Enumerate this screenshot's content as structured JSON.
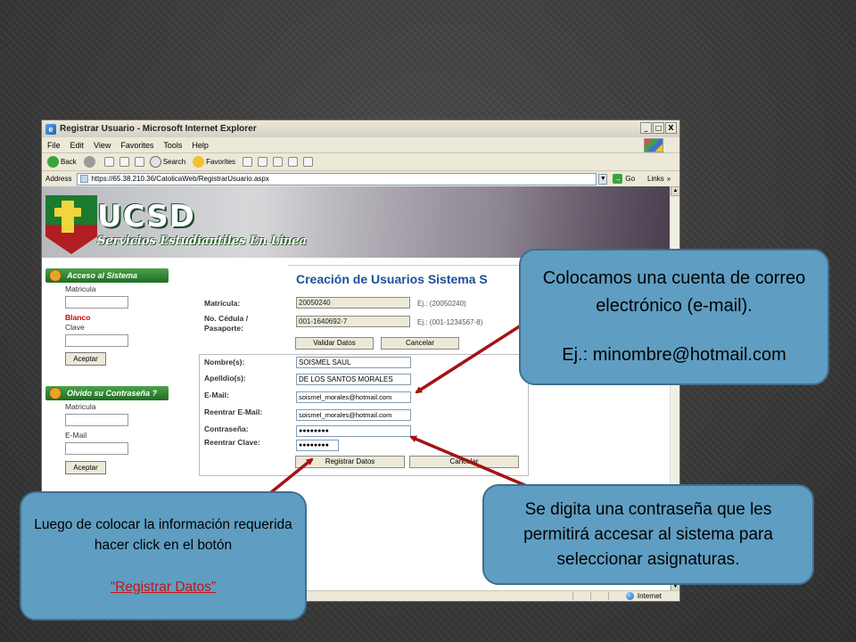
{
  "window": {
    "title": "Registrar Usuario - Microsoft Internet Explorer",
    "controls": [
      "_",
      "□",
      "X"
    ]
  },
  "menubar": [
    "File",
    "Edit",
    "View",
    "Favorites",
    "Tools",
    "Help"
  ],
  "toolbar": {
    "back": "Back",
    "search": "Search",
    "favorites": "Favorites"
  },
  "addressbar": {
    "label": "Address",
    "url": "https://65.38.210.36/CatolicaWeb/RegistrarUsuario.aspx",
    "go": "Go",
    "links": "Links",
    "more": "»"
  },
  "statusbar": {
    "zone": "Internet"
  },
  "banner": {
    "logo": "UCSD",
    "subtitle": "Servicios Estudiantiles En Línea"
  },
  "acceso": {
    "header": "Acceso al Sistema",
    "matricula_label": "Matricula",
    "error": "Blanco",
    "clave_label": "Clave",
    "button": "Aceptar"
  },
  "olvido": {
    "header": "Olvido su Contraseña ?",
    "matricula_label": "Matricula",
    "email_label": "E-Mail",
    "button": "Aceptar"
  },
  "form": {
    "title": "Creación de Usuarios Sistema S",
    "matricula_label": "Matrícula:",
    "matricula_value": "20050240",
    "matricula_hint": "Ej.: (20050240)",
    "cedula_label": "No. Cédula /",
    "cedula_label2": "Pasaporte:",
    "cedula_value": "001-1640692-7",
    "cedula_hint": "Ej.: (001-1234567-8)",
    "validar_button": "Validar Datos",
    "cancelar_button_1": "Cancelar",
    "nombre_label": "Nombre(s):",
    "nombre_value": "SOISMEL SAUL",
    "apellido_label": "Apelldio(s):",
    "apellido_value": "DE LOS SANTOS MORALES",
    "email_label": "E-Mail:",
    "email_value": "soismel_morales@hotmail.com",
    "reemail_label": "Reentrar E-Mail:",
    "reemail_value": "soismel_morales@hotmail.com",
    "pass_label": "Contraseña:",
    "pass_value": "●●●●●●●●",
    "repass_label": "Reentrar Clave:",
    "repass_value": "●●●●●●●●",
    "registrar_button": "Registrar Datos",
    "cancelar_button_2": "Cancelar"
  },
  "callouts": {
    "email_line1": "Colocamos una cuenta de correo electrónico (e-mail).",
    "email_line2": "Ej.: minombre@hotmail.com",
    "pass_text": "Se digita una contraseña que les permitirá accesar al sistema para seleccionar asignaturas.",
    "reg_text": "Luego de colocar la información requerida hacer click en el botón",
    "reg_link": "“Registrar Datos”"
  },
  "colors": {
    "callout_fill": "#5f9ec2",
    "arrow": "#a31414",
    "form_title": "#1f4f9a",
    "panel_header": "#1f6d22"
  }
}
